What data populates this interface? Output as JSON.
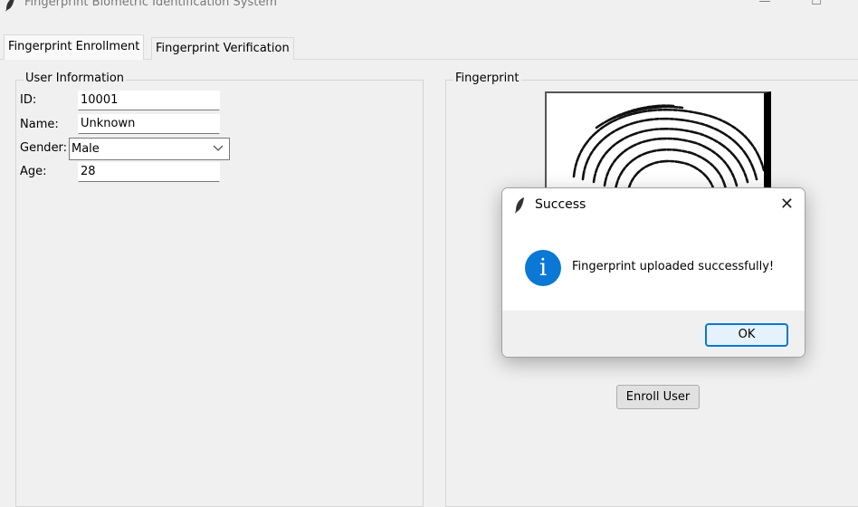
{
  "window": {
    "title": "Fingerprint Biometric Identification System",
    "app_icon": "feather-icon",
    "minimize_glyph": "—",
    "maximize_glyph": "☐"
  },
  "tabs": [
    {
      "label": "Fingerprint Enrollment",
      "active": true
    },
    {
      "label": "Fingerprint Verification",
      "active": false
    }
  ],
  "user_info": {
    "legend": "User Information",
    "id_label": "ID:",
    "id_value": "10001",
    "name_label": "Name:",
    "name_value": "Unknown",
    "gender_label": "Gender:",
    "gender_value": "Male",
    "age_label": "Age:",
    "age_value": "28"
  },
  "fingerprint": {
    "legend": "Fingerprint",
    "image_icon": "fingerprint-image",
    "enroll_label": "Enroll User"
  },
  "dialog": {
    "title": "Success",
    "icon": "feather-icon",
    "close_glyph": "✕",
    "info_glyph": "i",
    "message": "Fingerprint uploaded successfully!",
    "ok_label": "OK",
    "accent": "#0a78d4"
  }
}
